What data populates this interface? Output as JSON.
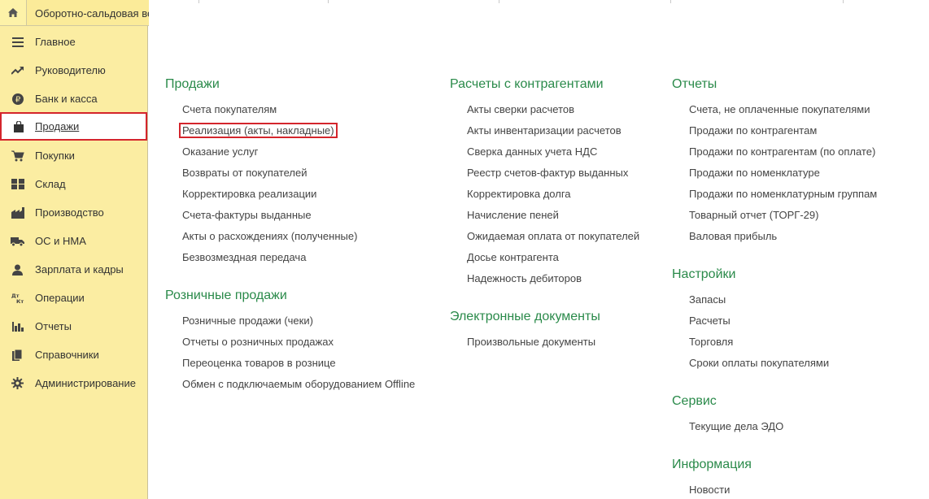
{
  "top": {
    "home_icon": "home-icon",
    "open_tab": "Оборотно-сальдовая ведомость"
  },
  "sidebar": {
    "items": [
      {
        "label": "Главное",
        "icon": "menu-lines-icon"
      },
      {
        "label": "Руководителю",
        "icon": "trend-icon"
      },
      {
        "label": "Банк и касса",
        "icon": "ruble-icon"
      },
      {
        "label": "Продажи",
        "icon": "shopping-bag-icon",
        "active": true
      },
      {
        "label": "Покупки",
        "icon": "cart-icon"
      },
      {
        "label": "Склад",
        "icon": "warehouse-icon"
      },
      {
        "label": "Производство",
        "icon": "factory-icon"
      },
      {
        "label": "ОС и НМА",
        "icon": "truck-icon"
      },
      {
        "label": "Зарплата и кадры",
        "icon": "person-icon"
      },
      {
        "label": "Операции",
        "icon": "dt-kt-icon"
      },
      {
        "label": "Отчеты",
        "icon": "bar-chart-icon"
      },
      {
        "label": "Справочники",
        "icon": "books-icon"
      },
      {
        "label": "Администрирование",
        "icon": "gear-icon"
      }
    ]
  },
  "content": {
    "sales": {
      "title": "Продажи",
      "links": [
        "Счета покупателям",
        "Реализация (акты, накладные)",
        "Оказание услуг",
        "Возвраты от покупателей",
        "Корректировка реализации",
        "Счета-фактуры выданные",
        "Акты о расхождениях (полученные)",
        "Безвозмездная передача"
      ]
    },
    "retail": {
      "title": "Розничные продажи",
      "links": [
        "Розничные продажи (чеки)",
        "Отчеты о розничных продажах",
        "Переоценка товаров в рознице",
        "Обмен с подключаемым оборудованием Offline"
      ]
    },
    "settlements": {
      "title": "Расчеты с контрагентами",
      "links": [
        "Акты сверки расчетов",
        "Акты инвентаризации расчетов",
        "Сверка данных учета НДС",
        "Реестр счетов-фактур выданных",
        "Корректировка долга",
        "Начисление пеней",
        "Ожидаемая оплата от покупателей",
        "Досье контрагента",
        "Надежность дебиторов"
      ]
    },
    "edocs": {
      "title": "Электронные документы",
      "links": [
        "Произвольные документы"
      ]
    },
    "reports": {
      "title": "Отчеты",
      "links": [
        "Счета, не оплаченные покупателями",
        "Продажи по контрагентам",
        "Продажи по контрагентам (по оплате)",
        "Продажи по номенклатуре",
        "Продажи по номенклатурным группам",
        "Товарный отчет (ТОРГ-29)",
        "Валовая прибыль"
      ]
    },
    "settings": {
      "title": "Настройки",
      "links": [
        "Запасы",
        "Расчеты",
        "Торговля",
        "Сроки оплаты покупателями"
      ]
    },
    "service": {
      "title": "Сервис",
      "links": [
        "Текущие дела ЭДО"
      ]
    },
    "info": {
      "title": "Информация",
      "links": [
        "Новости"
      ]
    }
  },
  "colors": {
    "sidebar_bg": "#fbeda2",
    "section_title": "#2a8a4a",
    "highlight": "#d4252c"
  }
}
